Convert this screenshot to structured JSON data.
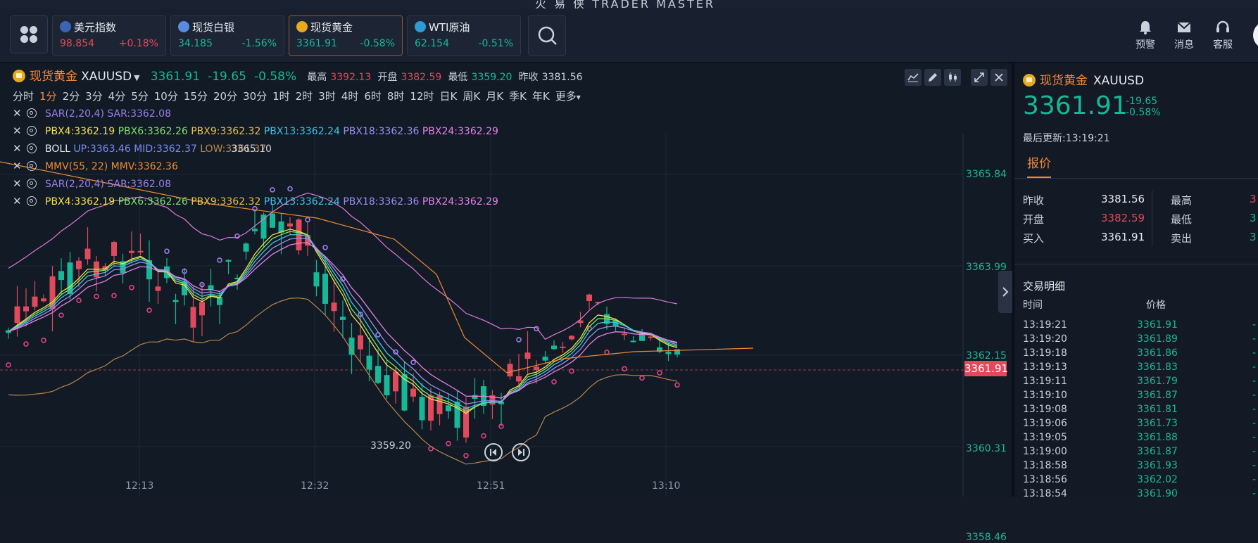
{
  "window": {
    "title": "火 易 侠   TRADER MASTER"
  },
  "topbar": {
    "cards": [
      {
        "name": "美元指数",
        "price": "98.854",
        "change": "+0.18%",
        "dir": "up",
        "flag_color": "#3b64b5",
        "active": false
      },
      {
        "name": "现货白银",
        "price": "34.185",
        "change": "-1.56%",
        "dir": "down",
        "flag_color": "#5a8be0",
        "active": false
      },
      {
        "name": "现货黄金",
        "price": "3361.91",
        "change": "-0.58%",
        "dir": "down",
        "flag_color": "#e8a820",
        "active": true
      },
      {
        "name": "WTI原油",
        "price": "62.154",
        "change": "-0.51%",
        "dir": "down",
        "flag_color": "#2d9bd6",
        "active": false
      }
    ],
    "icons": [
      {
        "label": "预警",
        "icon": "bell-icon"
      },
      {
        "label": "消息",
        "icon": "mail-icon"
      },
      {
        "label": "客服",
        "icon": "headset-icon"
      }
    ]
  },
  "chart": {
    "symbol_name": "现货黄金",
    "symbol_code": "XAUUSD",
    "price": "3361.91",
    "change": "-19.65",
    "change_pct": "-0.58%",
    "high_label": "最高",
    "high": "3392.13",
    "open_label": "开盘",
    "open": "3382.59",
    "low_label": "最低",
    "low": "3359.20",
    "prev_label": "昨收",
    "prev": "3381.56",
    "periods": [
      "分时",
      "1分",
      "2分",
      "3分",
      "4分",
      "5分",
      "10分",
      "15分",
      "20分",
      "30分",
      "1时",
      "2时",
      "3时",
      "4时",
      "6时",
      "8时",
      "12时",
      "日K",
      "周K",
      "月K",
      "季K",
      "年K",
      "更多"
    ],
    "active_period": "1分",
    "indicators": [
      {
        "segments": [
          {
            "text": "SAR(2,20,4)",
            "color": "#9b7fe8"
          },
          {
            "text": " SAR:3362.08",
            "color": "#9b7fe8"
          }
        ]
      },
      {
        "segments": [
          {
            "text": "PBX4:3362.19",
            "color": "#f4e04d"
          },
          {
            "text": " PBX6:3362.26",
            "color": "#7fe36a"
          },
          {
            "text": " PBX9:3362.32",
            "color": "#e8c04a"
          },
          {
            "text": " PBX13:3362.24",
            "color": "#3dc4e6"
          },
          {
            "text": " PBX18:3362.36",
            "color": "#9b8ff0"
          },
          {
            "text": " PBX24:3362.29",
            "color": "#e680e8"
          }
        ]
      },
      {
        "segments": [
          {
            "text": "BOLL",
            "color": "#e6eaf0"
          },
          {
            "text": "  UP:3363.46",
            "color": "#7b8cf2"
          },
          {
            "text": "  MID:3362.37",
            "color": "#7b8cf2"
          },
          {
            "text": "  LOW:3361.37",
            "color": "#b8864a"
          }
        ]
      },
      {
        "segments": [
          {
            "text": "MMV(55, 22)",
            "color": "#f08a30"
          },
          {
            "text": " MMV:3362.36",
            "color": "#f08a30"
          }
        ]
      },
      {
        "segments": [
          {
            "text": "SAR(2,20,4)",
            "color": "#9b7fe8"
          },
          {
            "text": " SAR:3362.08",
            "color": "#9b7fe8"
          }
        ]
      },
      {
        "segments": [
          {
            "text": "PBX4:3362.19",
            "color": "#f4e04d"
          },
          {
            "text": " PBX6:3362.26",
            "color": "#7fe36a"
          },
          {
            "text": " PBX9:3362.32",
            "color": "#e8c04a"
          },
          {
            "text": " PBX13:3362.24",
            "color": "#3dc4e6"
          },
          {
            "text": " PBX18:3362.36",
            "color": "#9b8ff0"
          },
          {
            "text": " PBX24:3362.29",
            "color": "#e680e8"
          }
        ]
      }
    ],
    "price_axis": [
      "3365.84",
      "3363.99",
      "3362.15",
      "3360.31",
      "3358.46"
    ],
    "current_price_tag": "3361.91",
    "time_axis": [
      "12:13",
      "12:32",
      "12:51",
      "13:10"
    ],
    "high_marker": "3365.10",
    "low_marker": "3359.20",
    "colors": {
      "up": "#e04a5a",
      "down": "#17b897"
    }
  },
  "side": {
    "symbol_name": "现货黄金",
    "symbol_code": "XAUUSD",
    "price": "3361.91",
    "change": "-19.65",
    "change_pct": "-0.58%",
    "last_update": "最后更新:13:19:21",
    "tab": "报价",
    "quotes": [
      {
        "l1": "昨收",
        "v1": "3381.56",
        "l2": "最高",
        "v2": "3"
      },
      {
        "l1": "开盘",
        "v1": "3382.59",
        "l2": "最低",
        "v2": "3"
      },
      {
        "l1": "买入",
        "v1": "3361.91",
        "l2": "卖出",
        "v2": "3"
      }
    ],
    "trades_title": "交易明细",
    "trade_headers": {
      "time": "时间",
      "price": "价格"
    },
    "trades": [
      {
        "time": "13:19:21",
        "price": "3361.91",
        "dir": "-"
      },
      {
        "time": "13:19:20",
        "price": "3361.89",
        "dir": "-"
      },
      {
        "time": "13:19:18",
        "price": "3361.86",
        "dir": "-"
      },
      {
        "time": "13:19:13",
        "price": "3361.83",
        "dir": "-"
      },
      {
        "time": "13:19:11",
        "price": "3361.79",
        "dir": "-"
      },
      {
        "time": "13:19:10",
        "price": "3361.87",
        "dir": "-"
      },
      {
        "time": "13:19:08",
        "price": "3361.81",
        "dir": "-"
      },
      {
        "time": "13:19:06",
        "price": "3361.73",
        "dir": "-"
      },
      {
        "time": "13:19:05",
        "price": "3361.88",
        "dir": "-"
      },
      {
        "time": "13:19:00",
        "price": "3361.87",
        "dir": "-"
      },
      {
        "time": "13:18:58",
        "price": "3361.93",
        "dir": "-"
      },
      {
        "time": "13:18:56",
        "price": "3362.02",
        "dir": "-"
      },
      {
        "time": "13:18:54",
        "price": "3361.90",
        "dir": "-"
      }
    ]
  }
}
